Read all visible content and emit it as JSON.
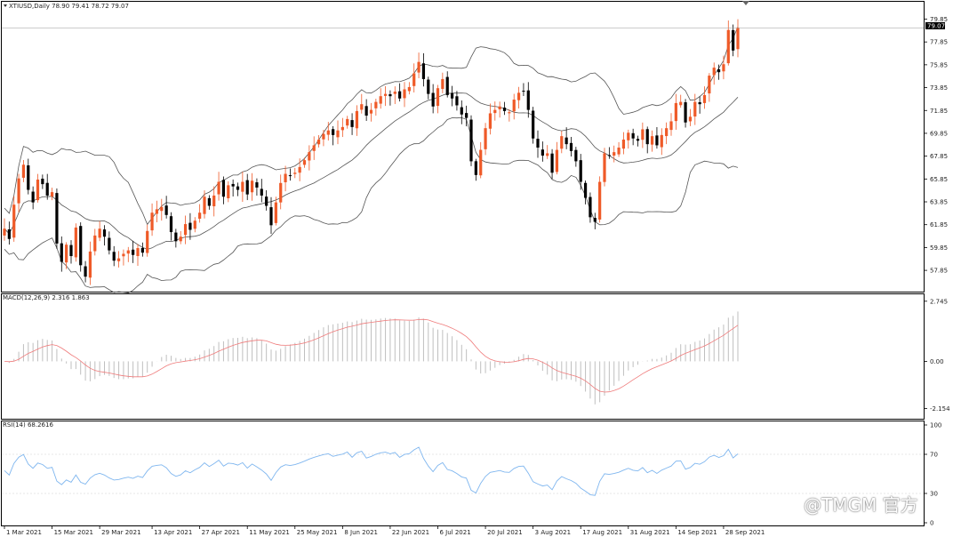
{
  "header": {
    "symbol_line": "XTIUSD,Daily  78.90 79.41 78.72 79.07"
  },
  "watermark": {
    "text": "@TMGM 官方"
  },
  "colors": {
    "bull": "#ef5a28",
    "bear": "#000000",
    "bands": "#555555",
    "macd_signal": "#ef7b7b",
    "macd_hist": "#bfbfbf",
    "rsi": "#7fb6ef",
    "frame": "#000000"
  },
  "chart_data": [
    {
      "type": "candlestick",
      "title": "XTIUSD,Daily  78.90 79.41 78.72 79.07",
      "y_ticks": [
        "79.85",
        "77.85",
        "75.85",
        "73.85",
        "71.85",
        "69.85",
        "67.85",
        "65.85",
        "63.85",
        "61.85",
        "59.85",
        "57.85"
      ],
      "ylim": [
        56.3,
        80.9
      ],
      "current_price": "79.07",
      "x_ticks": [
        "1 Mar 2021",
        "15 Mar 2021",
        "29 Mar 2021",
        "13 Apr 2021",
        "27 Apr 2021",
        "11 May 2021",
        "25 May 2021",
        "8 Jun 2021",
        "22 Jun 2021",
        "6 Jul 2021",
        "20 Jul 2021",
        "3 Aug 2021",
        "17 Aug 2021",
        "31 Aug 2021",
        "14 Sep 2021",
        "28 Sep 2021"
      ],
      "x_tick_index": [
        0,
        10,
        20,
        31,
        41,
        51,
        61,
        71,
        81,
        91,
        101,
        111,
        121,
        131,
        141,
        151
      ],
      "closes": [
        61.5,
        60.6,
        63.6,
        65.9,
        67.1,
        64.9,
        63.8,
        65.8,
        65.4,
        64.4,
        64.7,
        60.2,
        58.6,
        60.1,
        59.1,
        61.6,
        58.3,
        57.3,
        59.5,
        60.9,
        61.5,
        60.8,
        59.6,
        58.7,
        58.9,
        59.3,
        59.6,
        59.2,
        59.8,
        59.4,
        61.3,
        62.9,
        63.2,
        63.4,
        62.7,
        61.2,
        60.4,
        60.8,
        61.9,
        61.4,
        62.2,
        62.9,
        64.3,
        63.5,
        64.4,
        65.6,
        64.3,
        65.3,
        65.2,
        64.9,
        65.6,
        64.5,
        65.7,
        65.1,
        64.4,
        63.5,
        61.8,
        63.8,
        65.5,
        66.3,
        66.1,
        66.4,
        66.9,
        67.5,
        68.2,
        68.8,
        69.3,
        69.8,
        70.1,
        69.7,
        70.1,
        70.4,
        71.1,
        70.4,
        71.8,
        72.4,
        71.4,
        71.9,
        72.6,
        73.1,
        73.3,
        73.1,
        73.5,
        72.9,
        73.7,
        73.9,
        75.1,
        76.1,
        74.6,
        73.3,
        72.2,
        73.8,
        74.6,
        73.2,
        72.9,
        72.3,
        71.5,
        71.2,
        67.4,
        66.2,
        68.4,
        70.3,
        71.6,
        71.9,
        72.2,
        71.8,
        71.7,
        72.8,
        73.4,
        73.5,
        71.9,
        69.4,
        68.6,
        67.9,
        68.1,
        66.4,
        68.4,
        69.6,
        68.9,
        68.3,
        67.4,
        65.6,
        64.2,
        62.5,
        62.1,
        65.6,
        68.1,
        67.9,
        68.2,
        68.6,
        69.3,
        69.9,
        69.4,
        69.2,
        70.2,
        68.9,
        69.6,
        68.8,
        69.7,
        70.3,
        70.9,
        72.5,
        72.6,
        70.8,
        71.3,
        72.6,
        72.4,
        73.2,
        74.9,
        75.6,
        75.2,
        75.9,
        78.9,
        77.1,
        79.1
      ]
    },
    {
      "type": "histogram+line",
      "title": "MACD(12,26,9) 2.316 1.863",
      "y_ticks": [
        "2.745",
        "0.00",
        "-2.154"
      ],
      "ylim": [
        -2.5,
        2.9
      ]
    },
    {
      "type": "line",
      "title": "RSI(14) 68.2616",
      "y_ticks": [
        "100",
        "70",
        "30",
        "0"
      ],
      "ylim": [
        0,
        100
      ]
    }
  ]
}
